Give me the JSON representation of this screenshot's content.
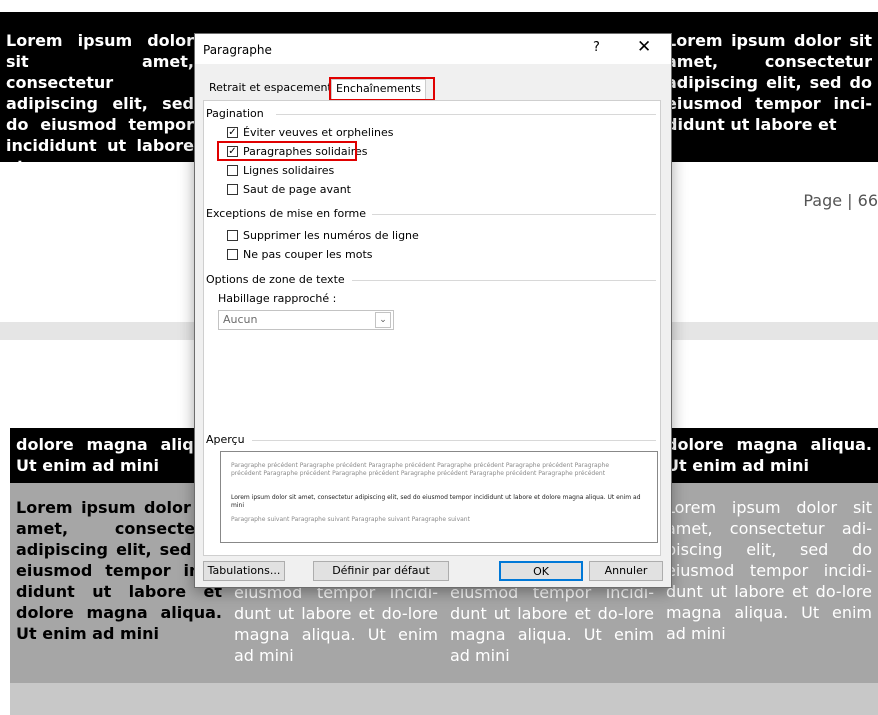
{
  "document": {
    "top_table": {
      "col1_text": "Lorem ipsum dolor sit amet, consectetur adipiscing elit, sed do eiusmod tempor incididunt ut labore et",
      "col4_text": "Lorem ipsum dolor sit amet, consectetur adipiscing elit, sed do eiusmod tempor inci-didunt ut labore et"
    },
    "page_number": "Page | 66",
    "bottom_table": {
      "header_left": "dolore magna aliqua. Ut enim ad mini",
      "header_right": "dolore magna aliqua. Ut enim ad mini",
      "cell_left": "Lorem ipsum dolor sit amet, consectetur adipiscing elit, sed do eiusmod tempor inci-didunt ut labore et dolore magna aliqua. Ut enim ad mini",
      "cell_right": "Lorem ipsum dolor sit amet, consectetur adi-piscing elit, sed do eiusmod tempor incidi-dunt ut labore et do-lore magna aliqua. Ut enim ad mini",
      "cell_mid1": "eiusmod tempor incidi-dunt ut labore et do-lore magna aliqua. Ut enim ad mini",
      "cell_mid2": "eiusmod tempor incidi-dunt ut labore et do-lore magna aliqua. Ut enim ad mini"
    }
  },
  "dialog": {
    "title": "Paragraphe",
    "help_icon": "?",
    "close_icon": "✕",
    "tabs": {
      "indent_spacing": "Retrait et espacement",
      "line_page_breaks": "Enchaînements"
    },
    "pagination": {
      "title": "Pagination",
      "items": [
        {
          "label": "Éviter veuves et orphelines",
          "checked": true
        },
        {
          "label": "Paragraphes solidaires",
          "checked": true
        },
        {
          "label": "Lignes solidaires",
          "checked": false
        },
        {
          "label": "Saut de page avant",
          "checked": false
        }
      ]
    },
    "formatting_exceptions": {
      "title": "Exceptions de mise en forme",
      "items": [
        {
          "label": "Supprimer les numéros de ligne",
          "checked": false
        },
        {
          "label": "Ne pas couper les mots",
          "checked": false
        }
      ]
    },
    "textbox_options": {
      "title": "Options de zone de texte",
      "wrap_label": "Habillage rapproché :",
      "wrap_value": "Aucun"
    },
    "preview": {
      "title": "Aperçu",
      "previous_text": "Paragraphe précédent Paragraphe précédent Paragraphe précédent Paragraphe précédent Paragraphe précédent Paragraphe précédent Paragraphe précédent Paragraphe précédent Paragraphe précédent Paragraphe précédent Paragraphe précédent",
      "current_text": "Lorem ipsum dolor sit amet, consectetur adipiscing elit, sed do eiusmod tempor incididunt ut labore et dolore magna aliqua. Ut enim ad mini",
      "next_text": "Paragraphe suivant Paragraphe suivant Paragraphe suivant Paragraphe suivant"
    },
    "buttons": {
      "tabs_button": "Tabulations...",
      "default_button": "Définir par défaut",
      "ok": "OK",
      "cancel": "Annuler"
    }
  }
}
